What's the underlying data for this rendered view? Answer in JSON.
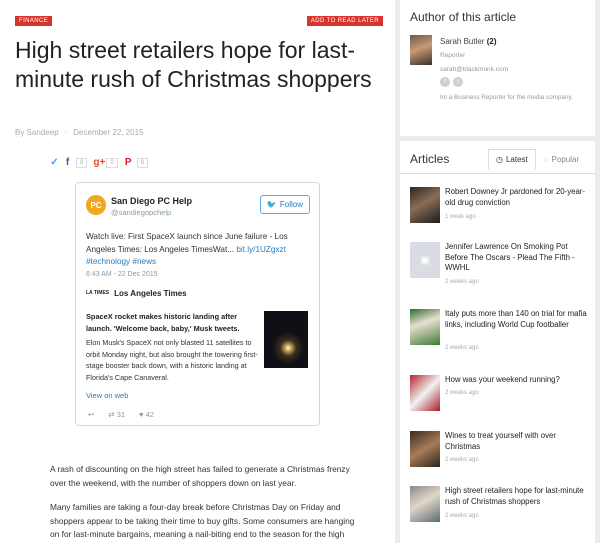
{
  "article": {
    "category": "FINANCE",
    "read_later": "ADD TO READ LATER",
    "title": "High street retailers hope for last-minute rush of Christmas shoppers",
    "author": "By Sandeep",
    "date": "December 22, 2015",
    "share_counts": {
      "facebook": "0",
      "google": "0",
      "pinterest": "0"
    },
    "paragraphs": [
      "A rash of discounting on the high street has failed to generate a Christmas frenzy over the weekend, with the number of shoppers down on last year.",
      "Many families are taking a four-day break before Christmas Day on Friday and shoppers appear to be taking their time to buy gifts. Some consumers are hanging on for last-minute bargains, meaning a nail-biting end to the season for the high street."
    ]
  },
  "tweet": {
    "avatar_text": "PC",
    "name": "San Diego PC Help",
    "handle": "@sandiegopchelp",
    "follow": "Follow",
    "text": "Watch live: First SpaceX launch since June failure - Los Angeles Times: Los Angeles TimesWat...",
    "link": "bit.ly/1UZgxzt",
    "hashtags": "#technology #news",
    "time": "6:43 AM - 22 Dec 2015",
    "source_logo": "LA TIMES",
    "source": "Los Angeles Times",
    "card_title": "SpaceX rocket makes historic landing after launch. 'Welcome back, baby,' Musk tweets.",
    "card_desc": "Elon Musk's SpaceX not only blasted 11 satellites to orbit Monday night, but also brought the towering first-stage booster back down, with a historic landing at Florida's Cape Canaveral.",
    "view_on_web": "View on web",
    "retweets": "31",
    "likes": "42"
  },
  "author_box": {
    "title": "Author of this article",
    "name": "Sarah Butler",
    "count": "(2)",
    "role": "Reporter",
    "email": "sarah@blackmonk.com",
    "bio": "Im a Business Reporter for the media company."
  },
  "articles_box": {
    "title": "Articles",
    "tabs": [
      "Latest",
      "Popular"
    ],
    "items": [
      {
        "title": "Robert Downey Jr pardoned for 20-year-old drug conviction",
        "time": "1 week ago"
      },
      {
        "title": "Jennifer Lawrence On Smoking Pot Before The Oscars - Plead The Fifth - WWHL",
        "time": "2 weeks ago"
      },
      {
        "title": "Italy puts more than 140 on trial for mafia links, including World Cup footballer",
        "time": "2 weeks ago"
      },
      {
        "title": "How was your weekend running?",
        "time": "2 weeks ago"
      },
      {
        "title": "Wines to treat yourself with over Christmas",
        "time": "2 weeks ago"
      },
      {
        "title": "High street retailers hope for last-minute rush of Christmas shoppers",
        "time": "2 weeks ago"
      }
    ]
  },
  "icons": {
    "share": [
      "twitter-icon",
      "facebook-icon",
      "google-plus-icon",
      "pinterest-icon"
    ],
    "tweet": [
      "twitter-bird-icon",
      "reply-icon",
      "retweet-icon",
      "heart-icon"
    ],
    "tabs": [
      "clock-icon",
      "circle-icon"
    ]
  },
  "colors": {
    "accent_red": "#d9342b",
    "twitter_blue": "#2b7bb9"
  }
}
